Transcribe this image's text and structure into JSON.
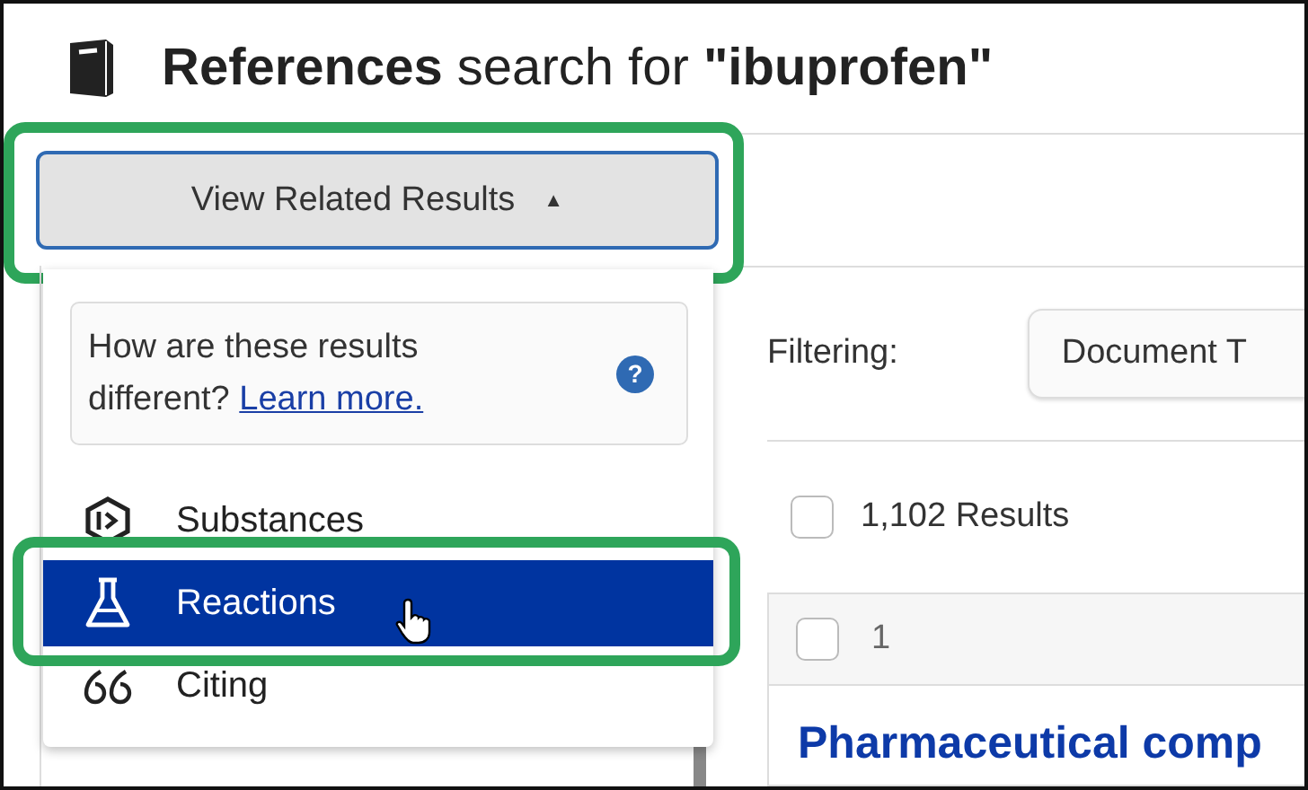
{
  "page": {
    "title": "**References** search for **\"ibuprofen\"**"
  },
  "related_button": {
    "label": "View Related Results",
    "caret": "▲",
    "expanded": true,
    "highlighted": true
  },
  "related_menu": {
    "info": {
      "text": "How are these results different?",
      "link": "Learn more.",
      "help": "?"
    },
    "items": [
      {
        "label": "Substances",
        "kind": "substance",
        "selected": false,
        "highlighted": false
      },
      {
        "label": "Reactions",
        "kind": "reaction",
        "selected": true,
        "highlighted": true
      },
      {
        "label": "Citing",
        "kind": "citing",
        "selected": false,
        "highlighted": false
      }
    ]
  },
  "filter": {
    "label": "Filtering:",
    "button": "Document T"
  },
  "results": {
    "count": "1,102 Results",
    "checked": false
  },
  "result_card": {
    "index": "1",
    "checked": false,
    "title": "Pharmaceutical comp"
  }
}
